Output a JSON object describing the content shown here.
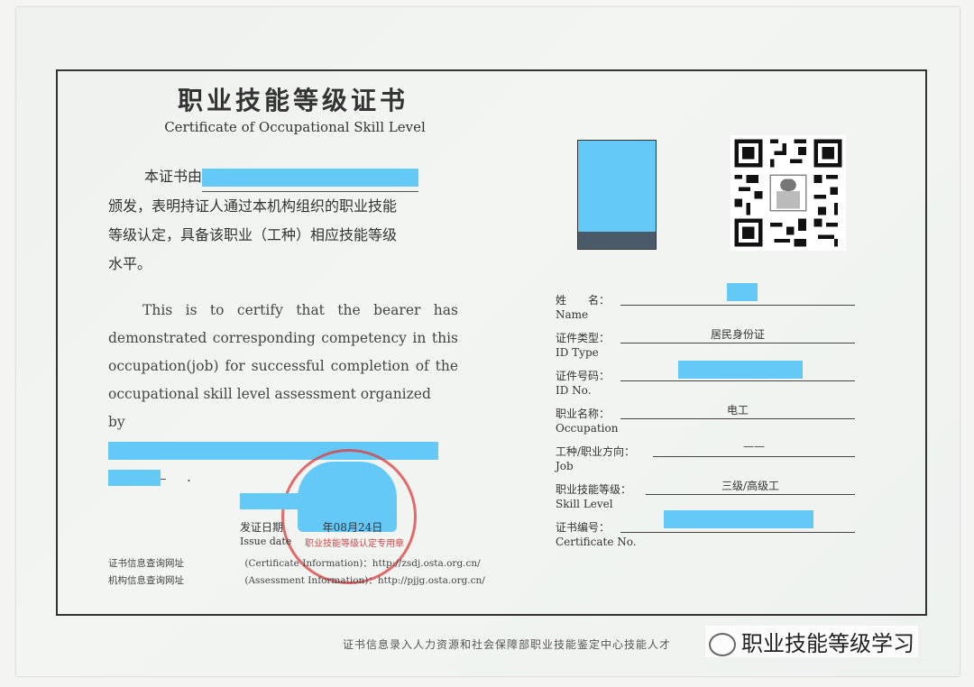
{
  "title_cn": "职业技能等级证书",
  "title_en": "Certificate of Occupational Skill Level",
  "cn_statement": {
    "line1_prefix": "本证书由",
    "line2": "颁发，表明持证人通过本机构组织的职业技能",
    "line3": "等级认定，具备该职业（工种）相应技能等级",
    "line4": "水平。"
  },
  "en_statement": {
    "text": "This is to certify that the bearer has demonstrated corresponding competency in this occupation(job) for successful completion of the occupational skill level assessment organized",
    "by": "by",
    "end": "."
  },
  "issue": {
    "label_cn": "发证日期",
    "date_fragment": "年08月24日",
    "label_en": "Issue date"
  },
  "seal_text": "职业技能等级认定专用章",
  "links": [
    {
      "label": "证书信息查询网址",
      "value": "(Certificate Information)：http://zsdj.osta.org.cn/"
    },
    {
      "label": "机构信息查询网址",
      "value": "(Assessment Information)：http://pjjg.osta.org.cn/"
    }
  ],
  "fields": {
    "name": {
      "cn": "姓　　名：",
      "en": "Name",
      "value": ""
    },
    "id_type": {
      "cn": "证件类型：",
      "en": "ID Type",
      "value": "居民身份证"
    },
    "id_no": {
      "cn": "证件号码：",
      "en": "ID No.",
      "value": ""
    },
    "occupation": {
      "cn": "职业名称：",
      "en": "Occupation",
      "value": "电工"
    },
    "job": {
      "cn": "工种/职业方向：",
      "en": "Job",
      "value": "——"
    },
    "skill_level": {
      "cn": "职业技能等级：",
      "en": "Skill Level",
      "value": "三级/高级工"
    },
    "cert_no": {
      "cn": "证书编号：",
      "en": "Certificate No.",
      "value": ""
    }
  },
  "footer": "证书信息录入人力资源和社会保障部职业技能鉴定中心技能人才",
  "watermark": "职业技能等级学习",
  "colors": {
    "redaction": "#65c9f8",
    "seal": "#dc3c3c",
    "frame": "#333333"
  }
}
